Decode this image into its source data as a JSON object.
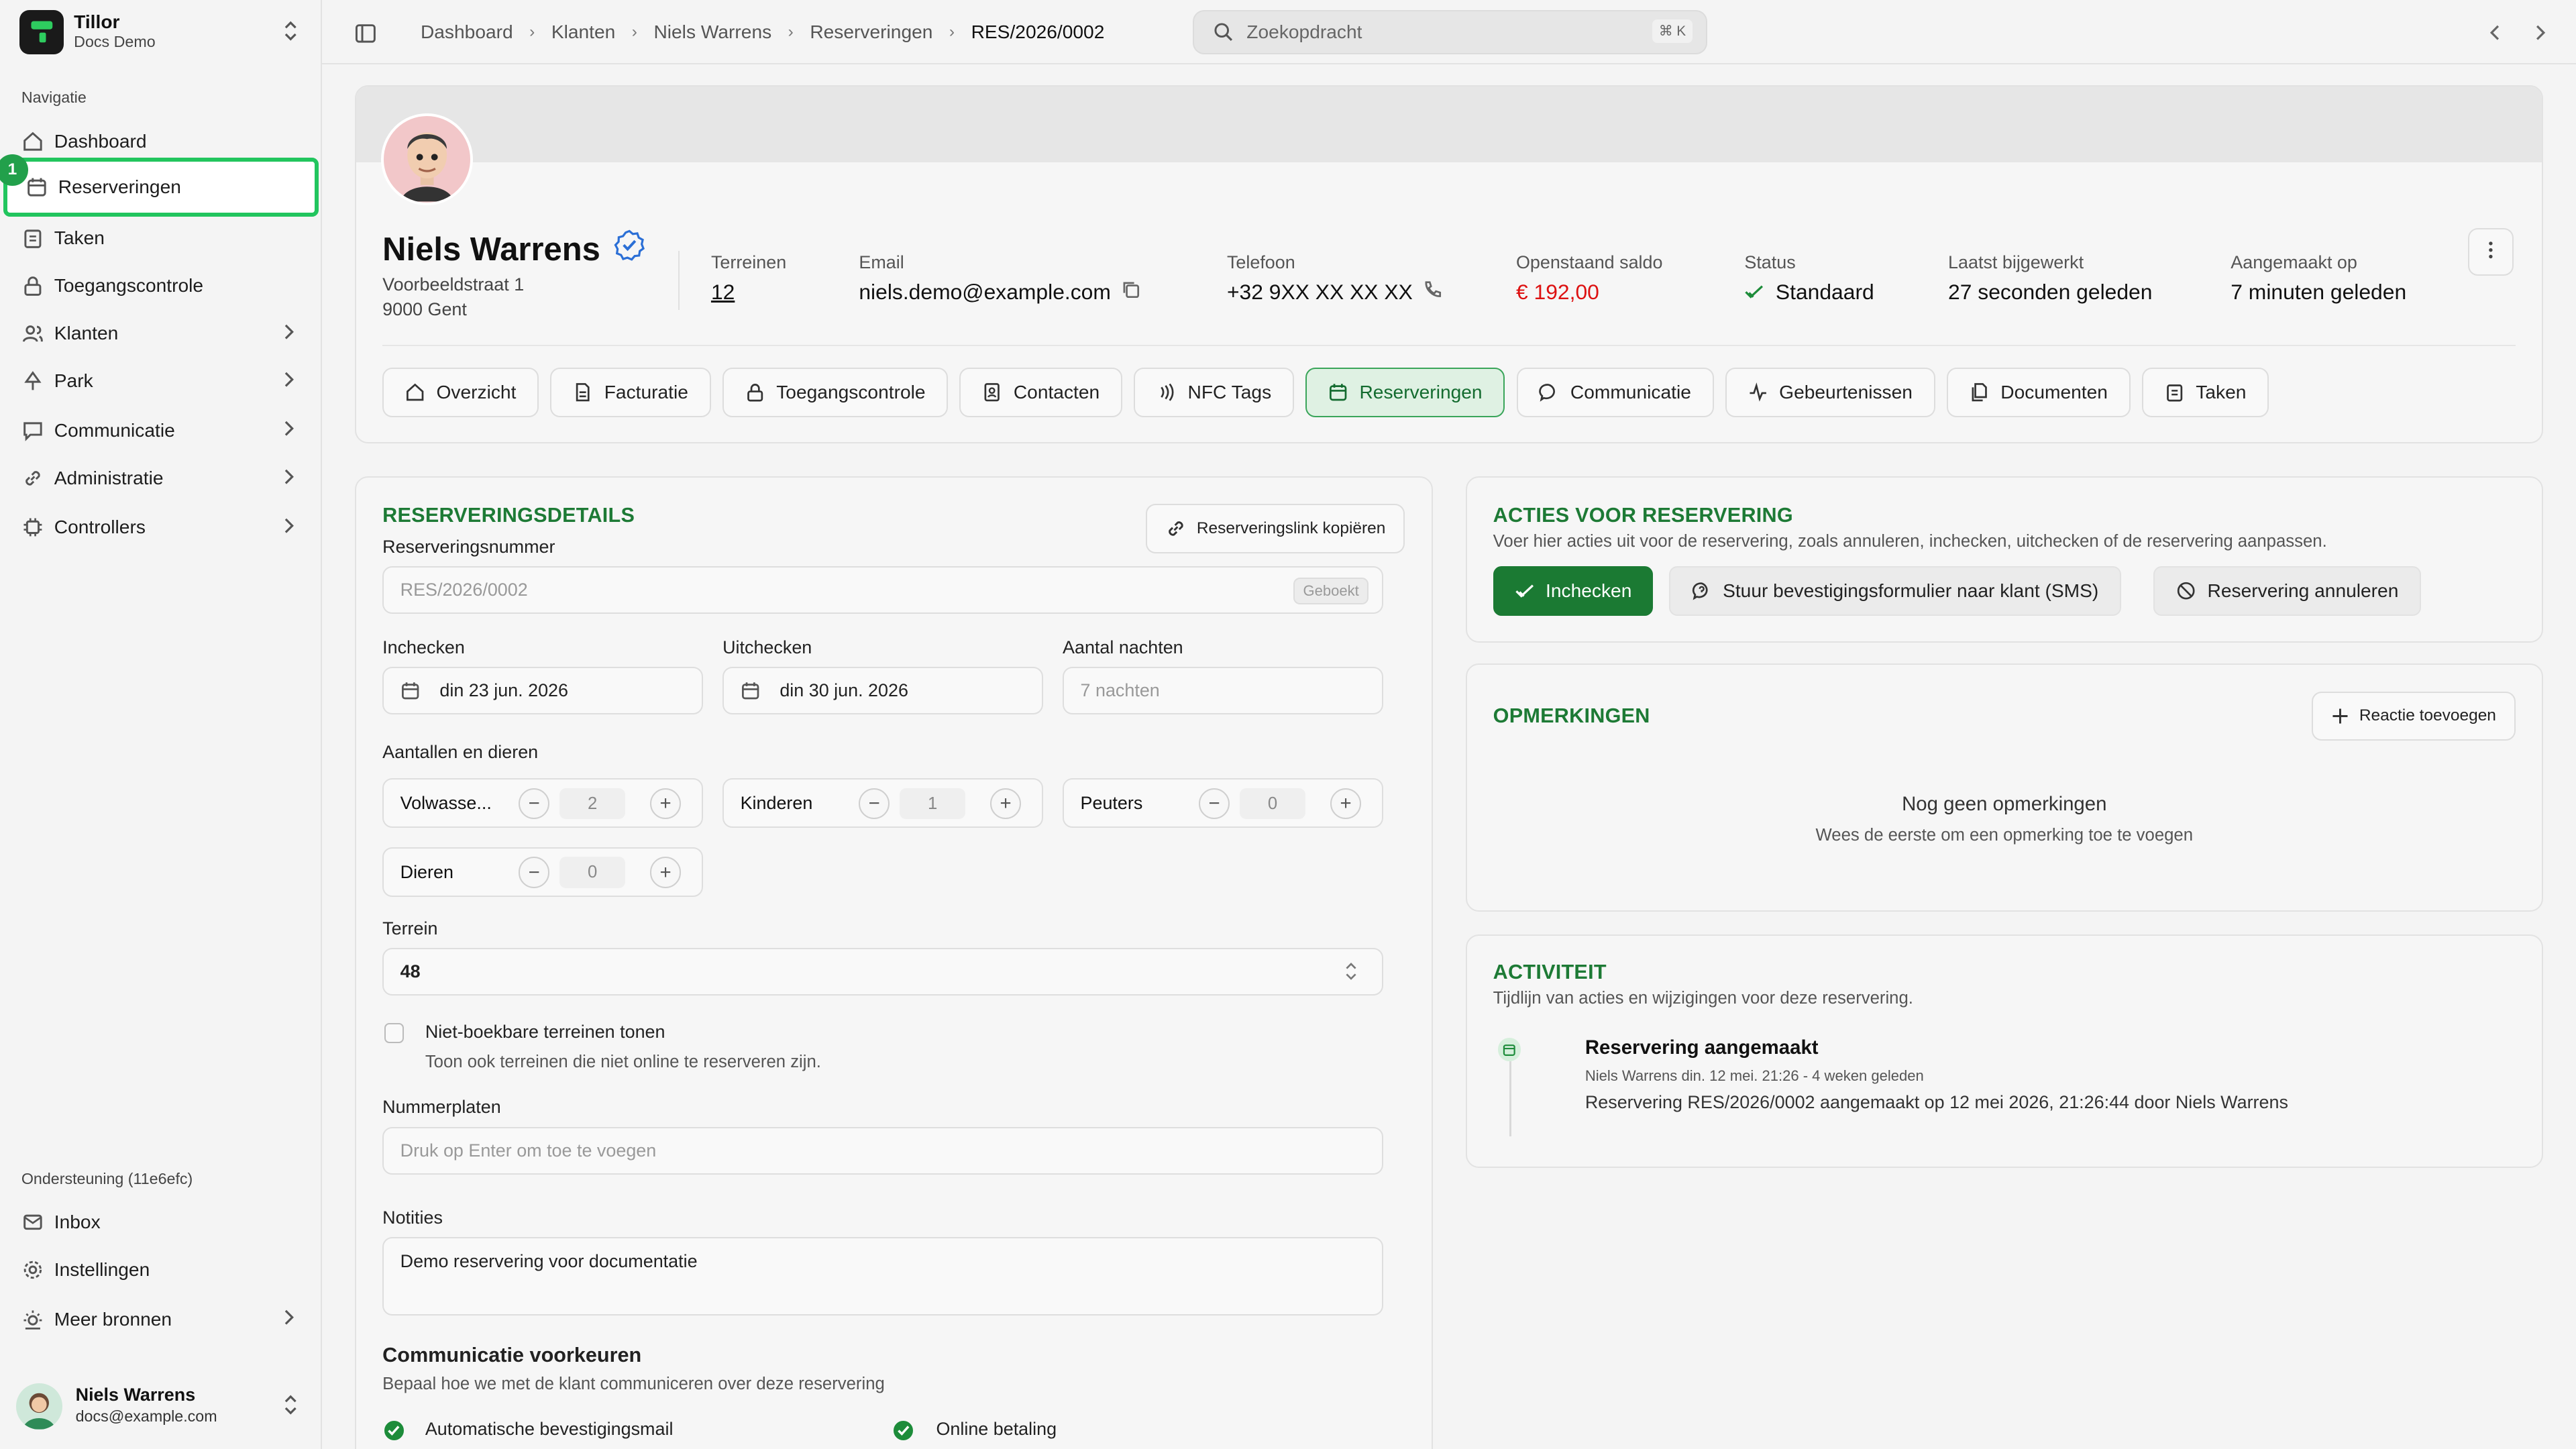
{
  "brand": {
    "name": "Tillor",
    "subtitle": "Docs Demo"
  },
  "sidebar": {
    "section_label": "Navigatie",
    "items": [
      {
        "label": "Dashboard",
        "icon": "home-icon"
      },
      {
        "label": "Reserveringen",
        "icon": "calendar-icon",
        "active": true,
        "badge": "1"
      },
      {
        "label": "Taken",
        "icon": "clipboard-icon"
      },
      {
        "label": "Toegangscontrole",
        "icon": "lock-icon"
      },
      {
        "label": "Klanten",
        "icon": "users-icon",
        "has_children": true
      },
      {
        "label": "Park",
        "icon": "tree-icon",
        "has_children": true
      },
      {
        "label": "Communicatie",
        "icon": "message-icon",
        "has_children": true
      },
      {
        "label": "Administratie",
        "icon": "link-icon",
        "has_children": true
      },
      {
        "label": "Controllers",
        "icon": "cpu-icon",
        "has_children": true
      }
    ],
    "support_label": "Ondersteuning (11e6efc)",
    "support_items": [
      {
        "label": "Inbox",
        "icon": "mail-icon"
      },
      {
        "label": "Instellingen",
        "icon": "gear-icon"
      },
      {
        "label": "Meer bronnen",
        "icon": "sun-icon",
        "has_children": true
      }
    ],
    "user": {
      "name": "Niels Warrens",
      "email": "docs@example.com"
    }
  },
  "topbar": {
    "breadcrumbs": [
      "Dashboard",
      "Klanten",
      "Niels Warrens",
      "Reserveringen",
      "RES/2026/0002"
    ],
    "search_placeholder": "Zoekopdracht",
    "search_shortcut": "⌘ K"
  },
  "profile": {
    "name": "Niels Warrens",
    "address_line1": "Voorbeeldstraat 1",
    "address_line2": "9000 Gent",
    "stats": [
      {
        "label": "Terreinen",
        "value": "12"
      },
      {
        "label": "Email",
        "value": "niels.demo@example.com"
      },
      {
        "label": "Telefoon",
        "value": "+32 9XX XX XX XX"
      },
      {
        "label": "Openstaand saldo",
        "value": "€ 192,00"
      },
      {
        "label": "Status",
        "value": "Standaard"
      },
      {
        "label": "Laatst bijgewerkt",
        "value": "27 seconden geleden"
      },
      {
        "label": "Aangemaakt op",
        "value": "7 minuten geleden"
      }
    ],
    "tabs": [
      "Overzicht",
      "Facturatie",
      "Toegangscontrole",
      "Contacten",
      "NFC Tags",
      "Reserveringen",
      "Communicatie",
      "Gebeurtenissen",
      "Documenten",
      "Taken"
    ],
    "active_tab": "Reserveringen"
  },
  "details": {
    "title": "RESERVERINGSDETAILS",
    "copy_link_label": "Reserveringslink kopiëren",
    "number_label": "Reserveringsnummer",
    "number_value": "RES/2026/0002",
    "number_status": "Geboekt",
    "checkin_label": "Inchecken",
    "checkin_value": "din 23 jun. 2026",
    "checkout_label": "Uitchecken",
    "checkout_value": "din 30 jun. 2026",
    "nights_label": "Aantal nachten",
    "nights_value": "7 nachten",
    "counts_label": "Aantallen en dieren",
    "counts": [
      {
        "label": "Volwasse...",
        "value": "2"
      },
      {
        "label": "Kinderen",
        "value": "1"
      },
      {
        "label": "Peuters",
        "value": "0"
      },
      {
        "label": "Dieren",
        "value": "0"
      }
    ],
    "terrain_label": "Terrein",
    "terrain_value": "48",
    "nonbookable_label": "Niet-boekbare terreinen tonen",
    "nonbookable_help": "Toon ook terreinen die niet online te reserveren zijn.",
    "plates_label": "Nummerplaten",
    "plates_placeholder": "Druk op Enter om toe te voegen",
    "notes_label": "Notities",
    "notes_value": "Demo reservering voor documentatie",
    "comm_title": "Communicatie voorkeuren",
    "comm_sub": "Bepaal hoe we met de klant communiceren over deze reservering",
    "comm_options": [
      "Automatische bevestigingsmail",
      "Online betaling"
    ]
  },
  "actions": {
    "title": "ACTIES VOOR RESERVERING",
    "description": "Voer hier acties uit voor de reservering, zoals annuleren, inchecken, uitchecken of de reservering aanpassen.",
    "checkin_btn": "Inchecken",
    "sms_btn": "Stuur bevestigingsformulier naar klant (SMS)",
    "cancel_btn": "Reservering annuleren"
  },
  "remarks": {
    "title": "OPMERKINGEN",
    "add_btn": "Reactie toevoegen",
    "empty_title": "Nog geen opmerkingen",
    "empty_sub": "Wees de eerste om een opmerking toe te voegen"
  },
  "activity": {
    "title": "ACTIVITEIT",
    "description": "Tijdlijn van acties en wijzigingen voor deze reservering.",
    "items": [
      {
        "title": "Reservering aangemaakt",
        "meta": "Niels Warrens  din. 12 mei. 21:26 - 4 weken geleden",
        "text": "Reservering RES/2026/0002 aangemaakt op 12 mei 2026, 21:26:44 door Niels Warrens"
      }
    ]
  },
  "colors": {
    "accent": "#1b7a33",
    "highlight": "#22c55e",
    "danger": "#dd1111"
  }
}
